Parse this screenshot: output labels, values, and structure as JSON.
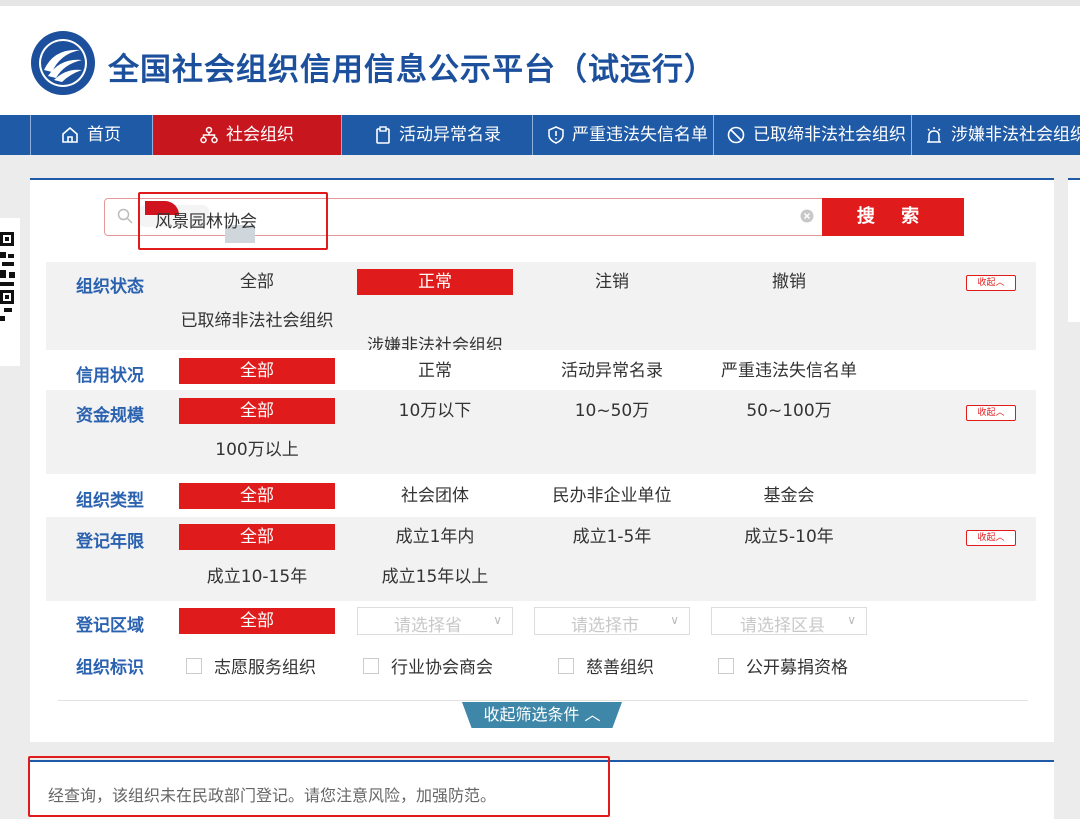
{
  "header": {
    "title": "全国社会组织信用信息公示平台（试运行）"
  },
  "nav": {
    "items": [
      {
        "label": "首页",
        "icon": "home-icon",
        "active": false
      },
      {
        "label": "社会组织",
        "icon": "org-chart-icon",
        "active": true
      },
      {
        "label": "活动异常名录",
        "icon": "clipboard-icon",
        "active": false
      },
      {
        "label": "严重违法失信名单",
        "icon": "shield-alert-icon",
        "active": false
      },
      {
        "label": "已取缔非法社会组织",
        "icon": "ban-icon",
        "active": false
      },
      {
        "label": "涉嫌非法社会组织",
        "icon": "alarm-light-icon",
        "active": false
      }
    ]
  },
  "search": {
    "value": "风景园林协会",
    "button_label": "搜 索"
  },
  "filters": {
    "status": {
      "label": "组织状态",
      "options": [
        "全部",
        "正常",
        "注销",
        "撤销",
        "已取缔非法社会组织",
        "涉嫌非法社会组织"
      ],
      "selected": "正常",
      "collapse": "收起"
    },
    "credit": {
      "label": "信用状况",
      "options": [
        "全部",
        "正常",
        "活动异常名录",
        "严重违法失信名单"
      ],
      "selected": "全部"
    },
    "funds": {
      "label": "资金规模",
      "options": [
        "全部",
        "10万以下",
        "10~50万",
        "50~100万",
        "100万以上"
      ],
      "selected": "全部",
      "collapse": "收起"
    },
    "type": {
      "label": "组织类型",
      "options": [
        "全部",
        "社会团体",
        "民办非企业单位",
        "基金会"
      ],
      "selected": "全部"
    },
    "years": {
      "label": "登记年限",
      "options": [
        "全部",
        "成立1年内",
        "成立1-5年",
        "成立5-10年",
        "成立10-15年",
        "成立15年以上"
      ],
      "selected": "全部",
      "collapse": "收起"
    },
    "region": {
      "label": "登记区域",
      "all": "全部",
      "province_placeholder": "请选择省",
      "city_placeholder": "请选择市",
      "county_placeholder": "请选择区县"
    },
    "marks": {
      "label": "组织标识",
      "options": [
        "志愿服务组织",
        "行业协会商会",
        "慈善组织",
        "公开募捐资格"
      ]
    }
  },
  "collapse_filters_label": "收起筛选条件",
  "result": {
    "message": "经查询，该组织未在民政部门登记。请您注意风险，加强防范。"
  },
  "colors": {
    "brand_blue": "#1f5aa6",
    "accent_red": "#e01b1b",
    "label_blue": "#2a62b0"
  }
}
